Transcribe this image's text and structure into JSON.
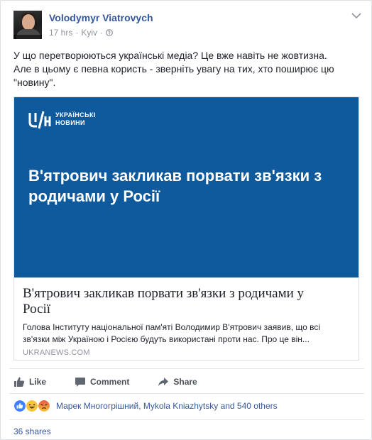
{
  "post": {
    "author": "Volodymyr Viatrovych",
    "time": "17 hrs",
    "location": "Kyiv",
    "text_lines": [
      "У що перетворюються українські медіа? Це вже навіть не жовтизна.",
      "Але в цьому є певна користь - зверніть увагу на тих, хто поширює цю",
      "\"новину\"."
    ]
  },
  "link_card": {
    "logo_lines": [
      "УКРАЇНСЬКІ",
      "НОВИНИ"
    ],
    "banner_title_lines": [
      "В'ятрович закликав порвати зв'язки з",
      "родичами у Росії"
    ],
    "title_lines": [
      "В'ятрович закликав порвати зв'язки з родичами у",
      "Росії"
    ],
    "description_lines": [
      "Голова Інституту національної пам'яті Володимир В'ятрович заявив, що всі",
      "зв'язки між Україною і Росією будуть використані проти нас. Про це він..."
    ],
    "domain": "UKRANEWS.COM"
  },
  "actions": {
    "like": "Like",
    "comment": "Comment",
    "share": "Share"
  },
  "reactions": {
    "summary": "Марек Многогрішний, Mykola Kniazhytsky and 540 others",
    "icons": [
      "like-reaction-icon",
      "haha-reaction-icon",
      "angry-reaction-icon"
    ]
  },
  "shares": "36 shares",
  "colors": {
    "link": "#365899",
    "banner": "#0e5a9d",
    "meta": "#90949c"
  }
}
